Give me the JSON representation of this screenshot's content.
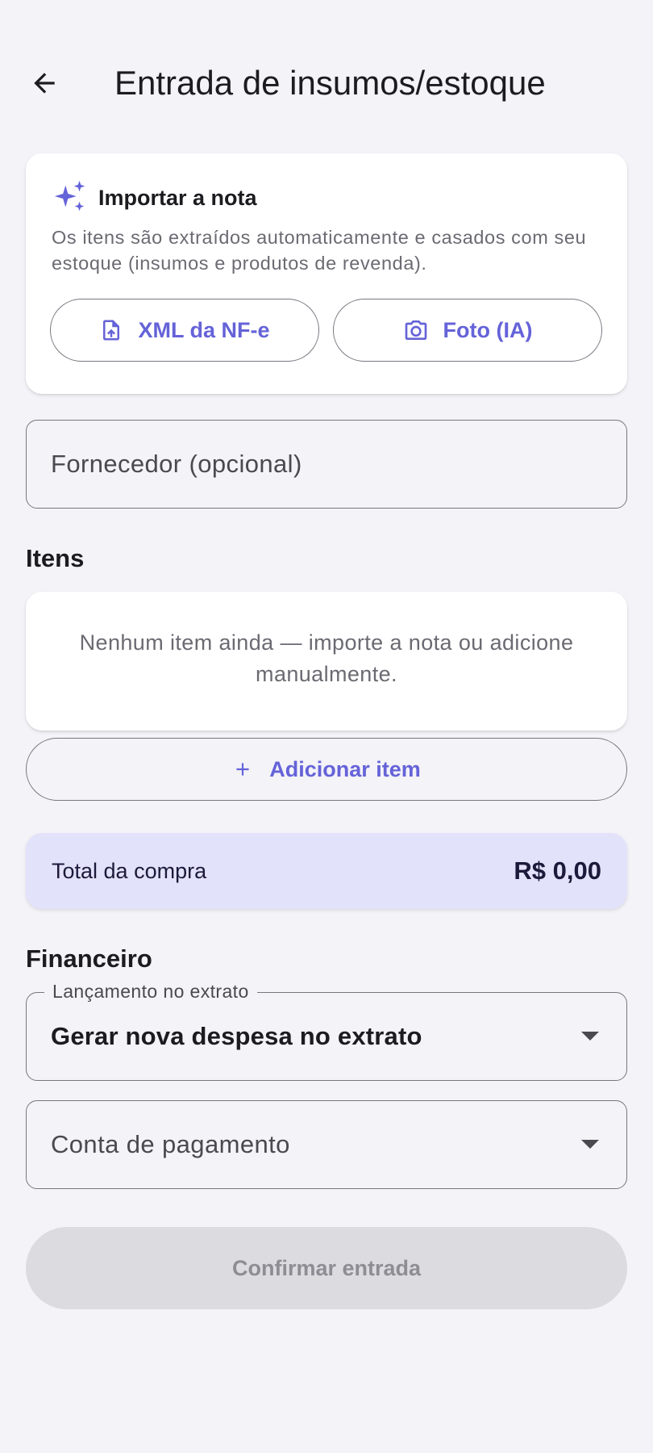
{
  "header": {
    "title": "Entrada de insumos/estoque",
    "back_icon": "arrow-left-icon"
  },
  "import_card": {
    "title": "Importar a nota",
    "icon": "sparkle-icon",
    "description": "Os itens são extraídos automaticamente e casados com seu estoque (insumos e produtos de revenda).",
    "xml_button": {
      "label": "XML da NF-e",
      "icon": "file-upload-icon"
    },
    "photo_button": {
      "label": "Foto (IA)",
      "icon": "camera-icon"
    }
  },
  "supplier": {
    "placeholder": "Fornecedor (opcional)"
  },
  "items": {
    "section_label": "Itens",
    "empty_message": "Nenhum item ainda — importe a nota ou adicione manualmente.",
    "add_button": {
      "label": "Adicionar item",
      "icon": "plus-icon"
    }
  },
  "total": {
    "label": "Total da compra",
    "value": "R$ 0,00"
  },
  "financial": {
    "section_label": "Financeiro",
    "launch_field": {
      "label": "Lançamento no extrato",
      "value": "Gerar nova despesa no extrato"
    },
    "account_field": {
      "placeholder": "Conta de pagamento"
    }
  },
  "confirm_button": {
    "label": "Confirmar entrada",
    "enabled": false
  },
  "colors": {
    "accent": "#6563d8",
    "background": "#f3f3f8",
    "total_bg": "#e3e2fb",
    "disabled_bg": "#dcdbe0"
  }
}
